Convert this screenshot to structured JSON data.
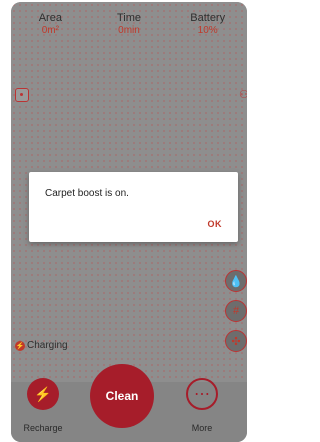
{
  "stats": [
    {
      "label": "Area",
      "value": "0m²"
    },
    {
      "label": "Time",
      "value": "0min"
    },
    {
      "label": "Battery",
      "value": "10%"
    }
  ],
  "status": {
    "charging_label": "Charging"
  },
  "controls": {
    "recharge_label": "Recharge",
    "clean_label": "Clean",
    "more_label": "More"
  },
  "dialog": {
    "message": "Carpet boost is on.",
    "ok_label": "OK"
  },
  "colors": {
    "accent": "#a61d2a",
    "text_accent": "#c0392b"
  }
}
